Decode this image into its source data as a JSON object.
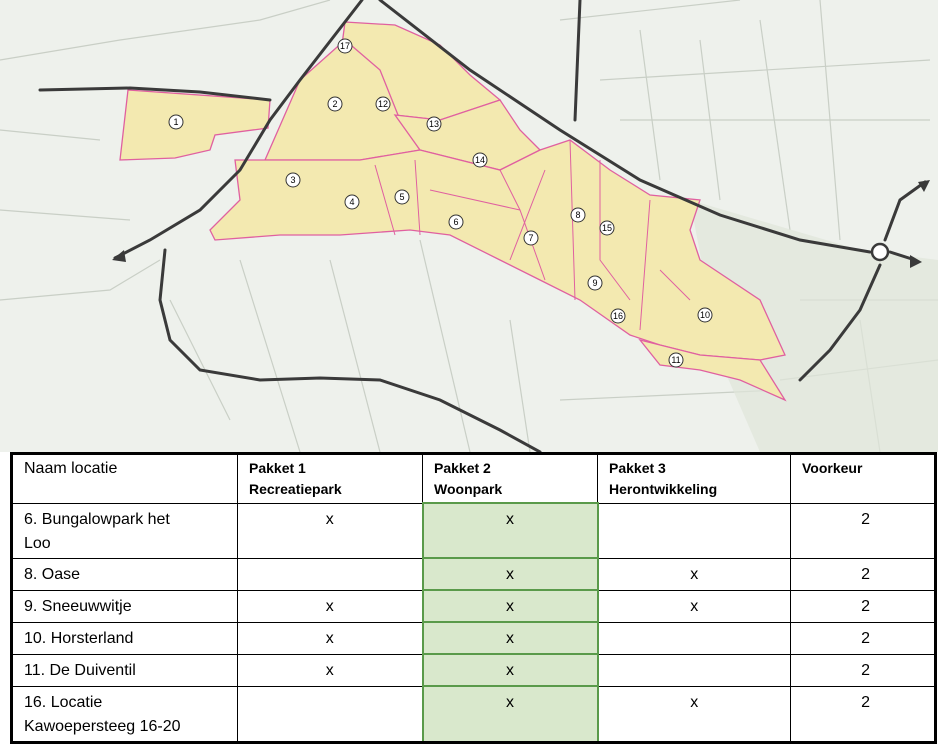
{
  "map": {
    "zones": [
      {
        "id": "1"
      },
      {
        "id": "2"
      },
      {
        "id": "3"
      },
      {
        "id": "4"
      },
      {
        "id": "5"
      },
      {
        "id": "6"
      },
      {
        "id": "7"
      },
      {
        "id": "8"
      },
      {
        "id": "9"
      },
      {
        "id": "10"
      },
      {
        "id": "11"
      },
      {
        "id": "12"
      },
      {
        "id": "13"
      },
      {
        "id": "14"
      },
      {
        "id": "15"
      },
      {
        "id": "16"
      },
      {
        "id": "17"
      }
    ],
    "colors": {
      "zone_fill": "#f3e9b0",
      "zone_border": "#e060a0",
      "road": "#3a3a3a",
      "background": "#eef1ec",
      "field_line": "#c9cfc6"
    }
  },
  "table": {
    "headers": [
      [
        "Naam locatie"
      ],
      [
        "Pakket 1",
        "Recreatiepark"
      ],
      [
        "Pakket 2",
        "Woonpark"
      ],
      [
        "Pakket 3",
        "Herontwikkeling"
      ],
      [
        "Voorkeur"
      ]
    ],
    "rows": [
      {
        "name": [
          "6. Bungalowpark het",
          "Loo"
        ],
        "p1": "x",
        "p2": "x",
        "p3": "",
        "pref": "2"
      },
      {
        "name": [
          "8. Oase"
        ],
        "p1": "",
        "p2": "x",
        "p3": "x",
        "pref": "2"
      },
      {
        "name": [
          "9. Sneeuwwitje"
        ],
        "p1": "x",
        "p2": "x",
        "p3": "x",
        "pref": "2"
      },
      {
        "name": [
          "10. Horsterland"
        ],
        "p1": "x",
        "p2": "x",
        "p3": "",
        "pref": "2"
      },
      {
        "name": [
          "11. De Duiventil"
        ],
        "p1": "x",
        "p2": "x",
        "p3": "",
        "pref": "2"
      },
      {
        "name": [
          "16. Locatie",
          "Kawoepersteeg 16-20"
        ],
        "p1": "",
        "p2": "x",
        "p3": "x",
        "pref": "2"
      }
    ],
    "highlight_color": "#d9e8cc"
  }
}
